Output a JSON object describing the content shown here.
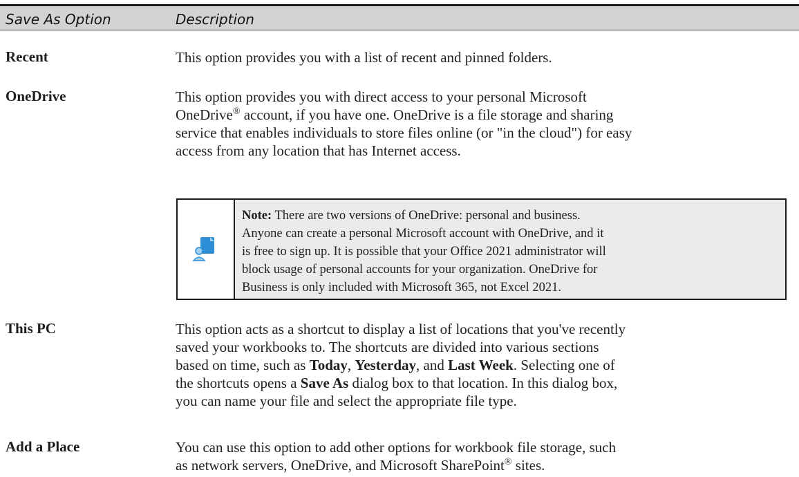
{
  "table": {
    "headers": [
      "Save As Option",
      "Description"
    ],
    "rows": [
      {
        "term": "Recent",
        "lines": [
          "This option provides you with a list of recent and pinned folders."
        ]
      },
      {
        "term": "OneDrive",
        "line1_a": "This option provides you with direct access to your personal Microsoft",
        "line2_a": "OneDrive",
        "line2_sup": "®",
        "line2_b": " account, if you have one. OneDrive is a file storage and sharing",
        "line3": "service that enables individuals to store files online (or \"in the cloud\") for easy",
        "line4": "access from any location that has Internet access."
      },
      {
        "term": "This PC",
        "line1": "This option acts as a shortcut to display a list of locations that you've recently",
        "line2": "saved your workbooks to. The shortcuts are divided into various sections",
        "line3_a": "based on time, such as ",
        "line3_b1": "Today",
        "line3_c": ", ",
        "line3_b2": "Yesterday",
        "line3_d": ", and ",
        "line3_b3": "Last Week",
        "line3_e": ". Selecting one of",
        "line4_a": "the shortcuts opens a ",
        "line4_b": "Save As",
        "line4_c": " dialog box to that location. In this dialog box,",
        "line5": "you can name your file and select the appropriate file type."
      },
      {
        "term": "Add a Place",
        "line1": "You can use this option to add other options for workbook file storage, such",
        "line2_a": "as network servers, OneDrive, and Microsoft SharePoint",
        "line2_sup": "®",
        "line2_b": " sites."
      }
    ]
  },
  "note": {
    "label": "Note:",
    "line1": " There are two versions of OneDrive: personal and business.",
    "line2": "Anyone can create a personal Microsoft account with OneDrive, and it",
    "line3": "is free to sign up. It is possible that your Office 2021 administrator will",
    "line4": "block usage of personal accounts for your organization. OneDrive for",
    "line5": "Business is only included with Microsoft 365, not Excel 2021.",
    "icon": "document-user-icon",
    "icon_colors": {
      "primary": "#2e8fd6",
      "secondary": "#9fd0f2"
    }
  }
}
